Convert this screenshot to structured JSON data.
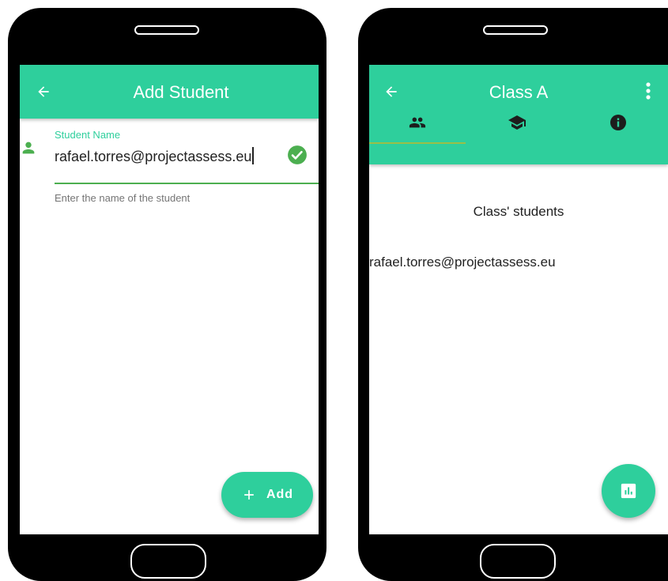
{
  "left_phone": {
    "appbar": {
      "title": "Add Student",
      "back_icon": "arrow-back-icon"
    },
    "field": {
      "label": "Student Name",
      "value": "rafael.torres@projectassess.eu",
      "helper": "Enter the name of the student",
      "leading_icon": "person-icon",
      "trailing_icon": "check-circle-icon"
    },
    "fab": {
      "label": "Add",
      "icon": "plus-icon"
    }
  },
  "right_phone": {
    "appbar": {
      "title": "Class A",
      "back_icon": "arrow-back-icon",
      "menu_icon": "more-vert-icon"
    },
    "tabs": [
      {
        "icon": "people-icon",
        "selected": true
      },
      {
        "icon": "school-icon",
        "selected": false
      },
      {
        "icon": "info-icon",
        "selected": false
      }
    ],
    "section_title": "Class' students",
    "students": [
      "rafael.torres@projectassess.eu"
    ],
    "fab": {
      "icon": "bar-chart-icon"
    }
  },
  "colors": {
    "accent": "#2ecf9c",
    "field_line": "#4caf50",
    "tab_indicator": "#9bbf46"
  }
}
